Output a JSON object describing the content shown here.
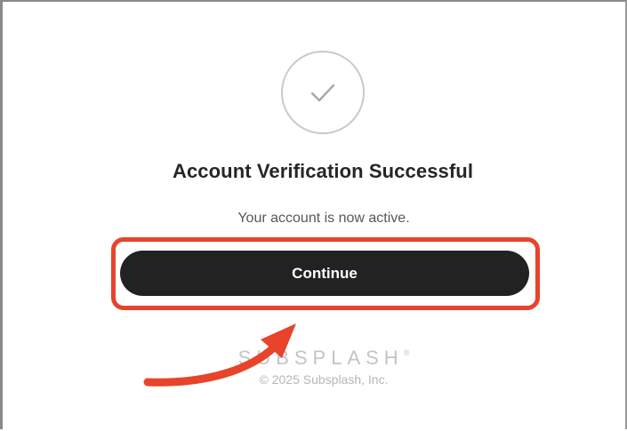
{
  "verification": {
    "title": "Account Verification Successful",
    "message": "Your account is now active.",
    "continue_label": "Continue",
    "status_icon": "check-circle-icon"
  },
  "footer": {
    "brand": "SUBSPLASH",
    "brand_mark": "®",
    "copyright": "© 2025 Subsplash, Inc."
  },
  "annotation": {
    "highlight_color": "#e8432b",
    "arrow_color": "#e8432b"
  },
  "colors": {
    "button_background": "#222222",
    "button_text": "#ffffff",
    "title_text": "#262626"
  }
}
